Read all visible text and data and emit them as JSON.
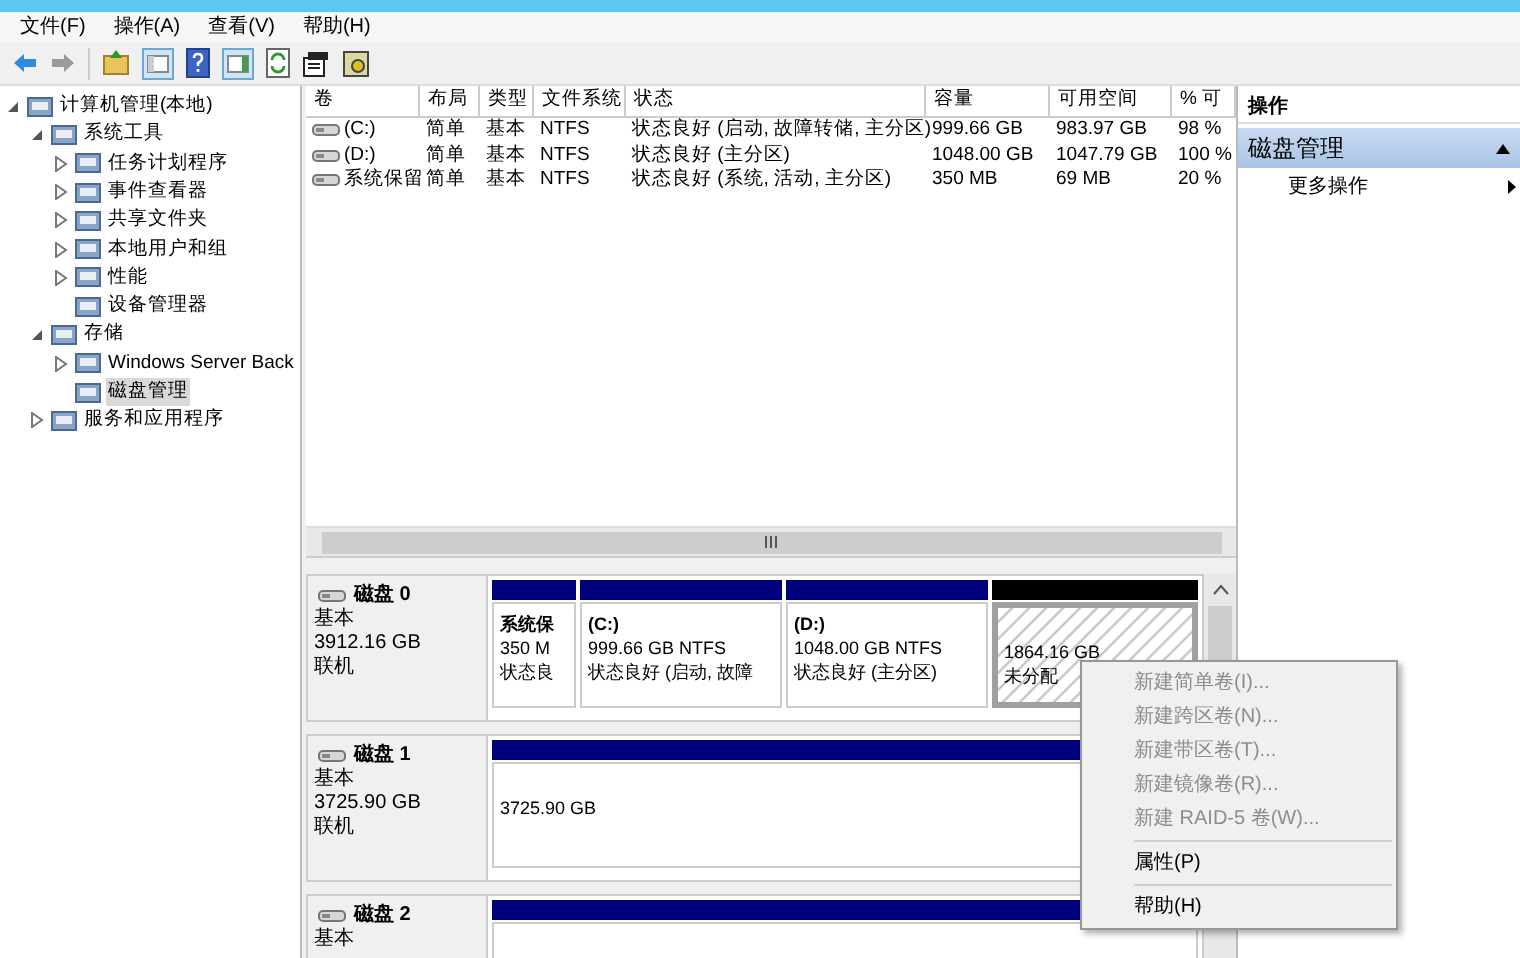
{
  "menu_bar": [
    "文件(F)",
    "操作(A)",
    "查看(V)",
    "帮助(H)"
  ],
  "tree": [
    {
      "label": "计算机管理(本地)",
      "expanded": true,
      "selected": false,
      "children": [
        {
          "label": "系统工具",
          "expanded": true,
          "selected": false,
          "children": [
            {
              "label": "任务计划程序",
              "expanded": false,
              "selected": false
            },
            {
              "label": "事件查看器",
              "expanded": false,
              "selected": false
            },
            {
              "label": "共享文件夹",
              "expanded": false,
              "selected": false
            },
            {
              "label": "本地用户和组",
              "expanded": false,
              "selected": false
            },
            {
              "label": "性能",
              "expanded": false,
              "selected": false
            },
            {
              "label": "设备管理器",
              "selected": false
            }
          ]
        },
        {
          "label": "存储",
          "expanded": true,
          "selected": false,
          "children": [
            {
              "label": "Windows Server Back",
              "expanded": false,
              "selected": false
            },
            {
              "label": "磁盘管理",
              "selected": true
            }
          ]
        },
        {
          "label": "服务和应用程序",
          "expanded": false,
          "selected": false
        }
      ]
    }
  ],
  "volume_table": {
    "columns": [
      "卷",
      "布局",
      "类型",
      "文件系统",
      "状态",
      "容量",
      "可用空间",
      "% 可"
    ],
    "rows": [
      [
        "(C:)",
        "简单",
        "基本",
        "NTFS",
        "状态良好 (启动, 故障转储, 主分区)",
        "999.66 GB",
        "983.97 GB",
        "98 %"
      ],
      [
        "(D:)",
        "简单",
        "基本",
        "NTFS",
        "状态良好 (主分区)",
        "1048.00 GB",
        "1047.79 GB",
        "100 %"
      ],
      [
        "系统保留",
        "简单",
        "基本",
        "NTFS",
        "状态良好 (系统, 活动, 主分区)",
        "350 MB",
        "69 MB",
        "20 %"
      ]
    ]
  },
  "disks": [
    {
      "name": "磁盘 0",
      "type": "基本",
      "size": "3912.16 GB",
      "status": "联机",
      "partitions": [
        {
          "kind": "primary",
          "selected": false,
          "name": "系统保",
          "size": "350 M",
          "status": "状态良"
        },
        {
          "kind": "primary",
          "selected": false,
          "name": "(C:)",
          "size": "999.66 GB NTFS",
          "status": "状态良好 (启动, 故障"
        },
        {
          "kind": "primary",
          "selected": false,
          "name": "(D:)",
          "size": "1048.00 GB NTFS",
          "status": "状态良好 (主分区)"
        },
        {
          "kind": "unallocated",
          "selected": true,
          "size": "1864.16 GB",
          "status": "未分配"
        }
      ]
    },
    {
      "name": "磁盘 1",
      "type": "基本",
      "size": "3725.90 GB",
      "status": "联机",
      "partitions": [
        {
          "kind": "primary",
          "selected": false,
          "size": "3725.90 GB"
        }
      ]
    },
    {
      "name": "磁盘 2",
      "type": "基本",
      "partitions": [
        {
          "kind": "primary",
          "selected": false
        }
      ]
    }
  ],
  "actions_pane": {
    "title": "操作",
    "section": "磁盘管理",
    "section_expanded": true,
    "items": [
      "更多操作"
    ]
  },
  "context_menu": [
    {
      "label": "新建简单卷(I)...",
      "disabled": true
    },
    {
      "label": "新建跨区卷(N)...",
      "disabled": true
    },
    {
      "label": "新建带区卷(T)...",
      "disabled": true
    },
    {
      "label": "新建镜像卷(R)...",
      "disabled": true
    },
    {
      "label": "新建 RAID-5 卷(W)...",
      "disabled": true
    },
    {
      "kind": "separator"
    },
    {
      "label": "属性(P)",
      "disabled": false
    },
    {
      "kind": "separator"
    },
    {
      "label": "帮助(H)",
      "disabled": false
    }
  ]
}
